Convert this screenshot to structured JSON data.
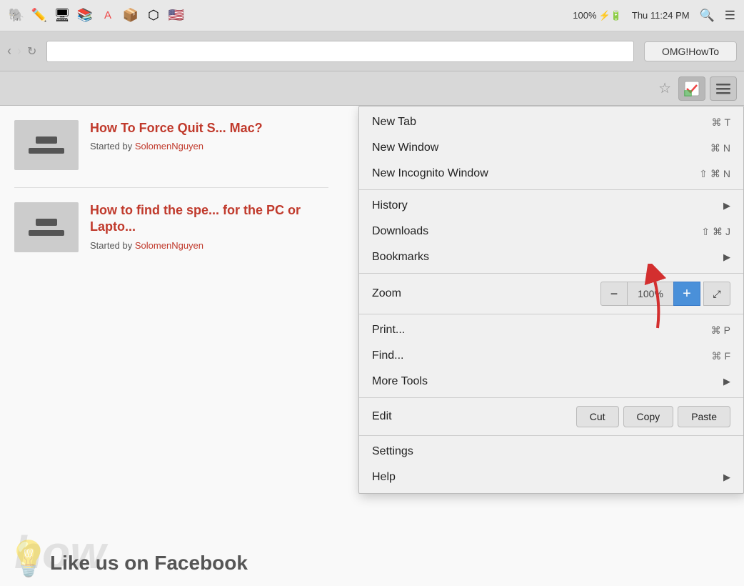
{
  "menubar": {
    "icons": [
      "🐘",
      "✏️",
      "🖥",
      "📚",
      "🔴",
      "📦",
      "⬡",
      "🇺🇸"
    ],
    "battery": "100%",
    "datetime": "Thu 11:24 PM"
  },
  "browser": {
    "search_placeholder": "OMG!HowTo"
  },
  "menu": {
    "sections": [
      {
        "items": [
          {
            "label": "New Tab",
            "shortcut": "⌘T",
            "hasArrow": false
          },
          {
            "label": "New Window",
            "shortcut": "⌘N",
            "hasArrow": false
          },
          {
            "label": "New Incognito Window",
            "shortcut": "⇧⌘N",
            "hasArrow": false
          }
        ]
      },
      {
        "items": [
          {
            "label": "History",
            "shortcut": "",
            "hasArrow": true
          },
          {
            "label": "Downloads",
            "shortcut": "⇧⌘J",
            "hasArrow": false
          },
          {
            "label": "Bookmarks",
            "shortcut": "",
            "hasArrow": true
          }
        ]
      },
      {
        "zoom": {
          "label": "Zoom",
          "minus": "−",
          "value": "100%",
          "plus": "+",
          "expand": "⤢"
        }
      },
      {
        "items": [
          {
            "label": "Print...",
            "shortcut": "⌘P",
            "hasArrow": false
          },
          {
            "label": "Find...",
            "shortcut": "⌘F",
            "hasArrow": false
          },
          {
            "label": "More Tools",
            "shortcut": "",
            "hasArrow": true
          }
        ]
      },
      {
        "edit": {
          "label": "Edit",
          "buttons": [
            "Cut",
            "Copy",
            "Paste"
          ]
        }
      },
      {
        "items": [
          {
            "label": "Settings",
            "shortcut": "",
            "hasArrow": false
          },
          {
            "label": "Help",
            "shortcut": "",
            "hasArrow": true
          }
        ]
      }
    ]
  },
  "articles": [
    {
      "title": "How To Force Quit S... Mac?",
      "byline": "Started by",
      "author": "SolomenNguyen"
    },
    {
      "title": "How to find the spe... for the PC or Lapto...",
      "byline": "Started by",
      "author": "SolomenNguyen"
    }
  ],
  "watermark": "how",
  "like_text": "Like us on Facebook"
}
